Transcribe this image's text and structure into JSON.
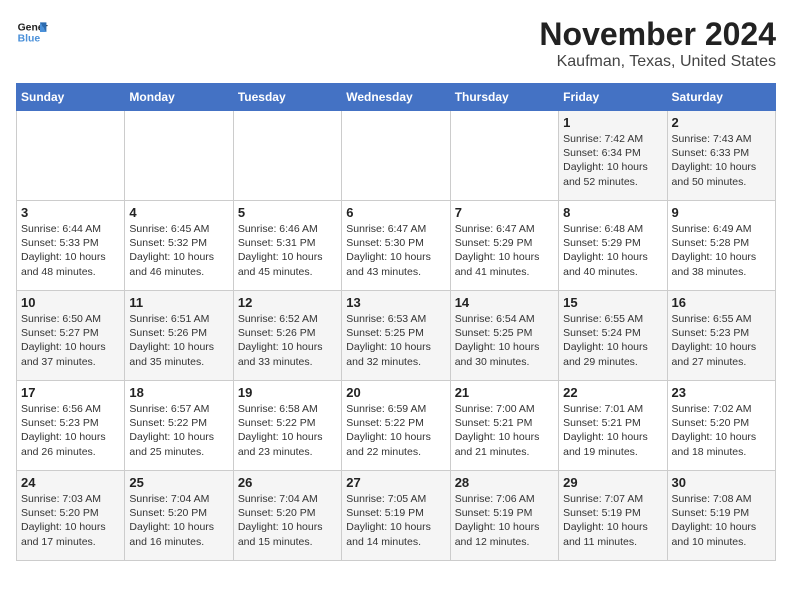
{
  "header": {
    "logo_line1": "General",
    "logo_line2": "Blue",
    "title": "November 2024",
    "subtitle": "Kaufman, Texas, United States"
  },
  "days_of_week": [
    "Sunday",
    "Monday",
    "Tuesday",
    "Wednesday",
    "Thursday",
    "Friday",
    "Saturday"
  ],
  "weeks": [
    [
      {
        "day": "",
        "info": ""
      },
      {
        "day": "",
        "info": ""
      },
      {
        "day": "",
        "info": ""
      },
      {
        "day": "",
        "info": ""
      },
      {
        "day": "",
        "info": ""
      },
      {
        "day": "1",
        "info": "Sunrise: 7:42 AM\nSunset: 6:34 PM\nDaylight: 10 hours and 52 minutes."
      },
      {
        "day": "2",
        "info": "Sunrise: 7:43 AM\nSunset: 6:33 PM\nDaylight: 10 hours and 50 minutes."
      }
    ],
    [
      {
        "day": "3",
        "info": "Sunrise: 6:44 AM\nSunset: 5:33 PM\nDaylight: 10 hours and 48 minutes."
      },
      {
        "day": "4",
        "info": "Sunrise: 6:45 AM\nSunset: 5:32 PM\nDaylight: 10 hours and 46 minutes."
      },
      {
        "day": "5",
        "info": "Sunrise: 6:46 AM\nSunset: 5:31 PM\nDaylight: 10 hours and 45 minutes."
      },
      {
        "day": "6",
        "info": "Sunrise: 6:47 AM\nSunset: 5:30 PM\nDaylight: 10 hours and 43 minutes."
      },
      {
        "day": "7",
        "info": "Sunrise: 6:47 AM\nSunset: 5:29 PM\nDaylight: 10 hours and 41 minutes."
      },
      {
        "day": "8",
        "info": "Sunrise: 6:48 AM\nSunset: 5:29 PM\nDaylight: 10 hours and 40 minutes."
      },
      {
        "day": "9",
        "info": "Sunrise: 6:49 AM\nSunset: 5:28 PM\nDaylight: 10 hours and 38 minutes."
      }
    ],
    [
      {
        "day": "10",
        "info": "Sunrise: 6:50 AM\nSunset: 5:27 PM\nDaylight: 10 hours and 37 minutes."
      },
      {
        "day": "11",
        "info": "Sunrise: 6:51 AM\nSunset: 5:26 PM\nDaylight: 10 hours and 35 minutes."
      },
      {
        "day": "12",
        "info": "Sunrise: 6:52 AM\nSunset: 5:26 PM\nDaylight: 10 hours and 33 minutes."
      },
      {
        "day": "13",
        "info": "Sunrise: 6:53 AM\nSunset: 5:25 PM\nDaylight: 10 hours and 32 minutes."
      },
      {
        "day": "14",
        "info": "Sunrise: 6:54 AM\nSunset: 5:25 PM\nDaylight: 10 hours and 30 minutes."
      },
      {
        "day": "15",
        "info": "Sunrise: 6:55 AM\nSunset: 5:24 PM\nDaylight: 10 hours and 29 minutes."
      },
      {
        "day": "16",
        "info": "Sunrise: 6:55 AM\nSunset: 5:23 PM\nDaylight: 10 hours and 27 minutes."
      }
    ],
    [
      {
        "day": "17",
        "info": "Sunrise: 6:56 AM\nSunset: 5:23 PM\nDaylight: 10 hours and 26 minutes."
      },
      {
        "day": "18",
        "info": "Sunrise: 6:57 AM\nSunset: 5:22 PM\nDaylight: 10 hours and 25 minutes."
      },
      {
        "day": "19",
        "info": "Sunrise: 6:58 AM\nSunset: 5:22 PM\nDaylight: 10 hours and 23 minutes."
      },
      {
        "day": "20",
        "info": "Sunrise: 6:59 AM\nSunset: 5:22 PM\nDaylight: 10 hours and 22 minutes."
      },
      {
        "day": "21",
        "info": "Sunrise: 7:00 AM\nSunset: 5:21 PM\nDaylight: 10 hours and 21 minutes."
      },
      {
        "day": "22",
        "info": "Sunrise: 7:01 AM\nSunset: 5:21 PM\nDaylight: 10 hours and 19 minutes."
      },
      {
        "day": "23",
        "info": "Sunrise: 7:02 AM\nSunset: 5:20 PM\nDaylight: 10 hours and 18 minutes."
      }
    ],
    [
      {
        "day": "24",
        "info": "Sunrise: 7:03 AM\nSunset: 5:20 PM\nDaylight: 10 hours and 17 minutes."
      },
      {
        "day": "25",
        "info": "Sunrise: 7:04 AM\nSunset: 5:20 PM\nDaylight: 10 hours and 16 minutes."
      },
      {
        "day": "26",
        "info": "Sunrise: 7:04 AM\nSunset: 5:20 PM\nDaylight: 10 hours and 15 minutes."
      },
      {
        "day": "27",
        "info": "Sunrise: 7:05 AM\nSunset: 5:19 PM\nDaylight: 10 hours and 14 minutes."
      },
      {
        "day": "28",
        "info": "Sunrise: 7:06 AM\nSunset: 5:19 PM\nDaylight: 10 hours and 12 minutes."
      },
      {
        "day": "29",
        "info": "Sunrise: 7:07 AM\nSunset: 5:19 PM\nDaylight: 10 hours and 11 minutes."
      },
      {
        "day": "30",
        "info": "Sunrise: 7:08 AM\nSunset: 5:19 PM\nDaylight: 10 hours and 10 minutes."
      }
    ]
  ]
}
